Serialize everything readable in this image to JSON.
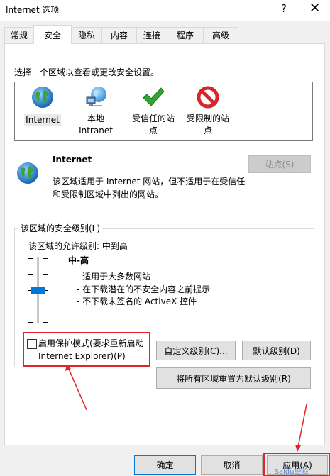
{
  "window": {
    "title": "Internet 选项",
    "help": "?",
    "close": "✕"
  },
  "tabs": [
    {
      "label": "常规"
    },
    {
      "label": "安全"
    },
    {
      "label": "隐私"
    },
    {
      "label": "内容"
    },
    {
      "label": "连接"
    },
    {
      "label": "程序"
    },
    {
      "label": "高级"
    }
  ],
  "security": {
    "instruction": "选择一个区域以查看或更改安全设置。",
    "zones": [
      {
        "label": "Internet",
        "icon": "globe-icon"
      },
      {
        "label": "本地\nIntranet",
        "icon": "network-globe-icon"
      },
      {
        "label": "受信任的站\n点",
        "icon": "green-check-icon"
      },
      {
        "label": "受限制的站\n点",
        "icon": "red-no-icon"
      }
    ],
    "selected_zone": {
      "title": "Internet",
      "description": "该区域适用于 Internet 网站，但不适用于在受信任和受限制区域中列出的网站。",
      "sites_button": "站点(S)"
    },
    "level_group_label": "该区域的安全级别(L)",
    "allowed_levels": "该区域的允许级别: 中到高",
    "level_name": "中-高",
    "level_details": [
      "- 适用于大多数网站",
      "- 在下载潜在的不安全内容之前提示",
      "- 不下载未签名的 ActiveX 控件"
    ],
    "protected_mode_label": "启用保护模式(要求重新启动 Internet Explorer)(P)",
    "protected_mode_checked": false,
    "custom_level_button": "自定义级别(C)...",
    "default_level_button": "默认级别(D)",
    "reset_all_button": "将所有区域重置为默认级别(R)"
  },
  "footer": {
    "ok": "确定",
    "cancel": "取消",
    "apply": "应用(A)"
  },
  "watermark": "Baidu经验",
  "colors": {
    "annotation_red": "#e0242a",
    "accent": "#0078d7",
    "check_green": "#2fa52f",
    "stop_red": "#d9262b"
  }
}
